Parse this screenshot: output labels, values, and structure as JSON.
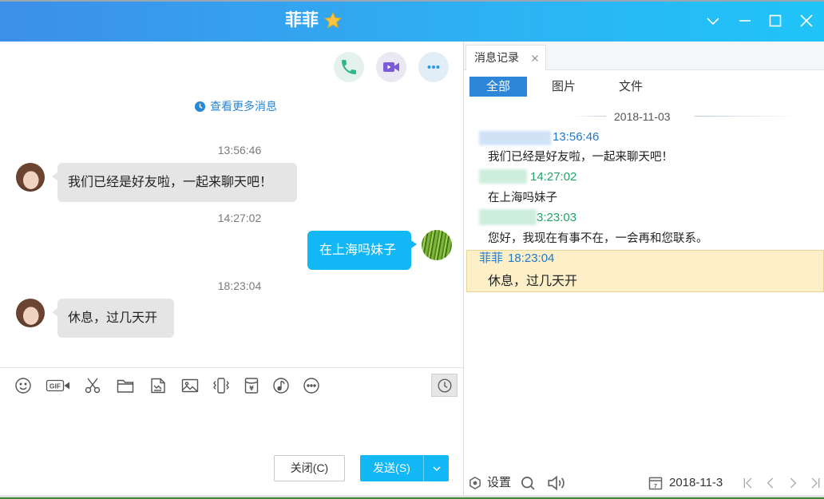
{
  "window": {
    "title": "菲菲",
    "controls": [
      "chevron-down-icon",
      "minimize-icon",
      "maximize-icon",
      "close-icon"
    ]
  },
  "chat": {
    "actions": [
      "phone-icon",
      "video-icon",
      "more-icon"
    ],
    "load_more_label": "查看更多消息",
    "messages": [
      {
        "from": "contact",
        "time": "13:56:46",
        "text": "我们已经是好友啦，一起来聊天吧！"
      },
      {
        "from": "me",
        "time": "14:27:02",
        "text": "在上海吗妹子"
      },
      {
        "from": "contact",
        "time": "18:23:04",
        "text": "休息，过几天开"
      }
    ]
  },
  "composer": {
    "toolbar_icons": [
      "emoji-icon",
      "gif-icon",
      "screenshot-scissors-icon",
      "folder-icon",
      "document-icon",
      "image-icon",
      "shake-icon",
      "red-packet-icon",
      "music-icon",
      "more-icon",
      "history-clock-icon"
    ],
    "gif_glyph": "GIF",
    "red_packet_glyph": "¥",
    "close_label": "关闭(C)",
    "send_label": "发送(S)"
  },
  "history": {
    "tab_label": "消息记录",
    "filters": [
      {
        "label": "全部",
        "selected": true
      },
      {
        "label": "图片",
        "selected": false
      },
      {
        "label": "文件",
        "selected": false
      }
    ],
    "date_header": "2018-11-03",
    "entries": [
      {
        "sender_redacted": true,
        "time": "13:56:46",
        "text": "我们已经是好友啦，一起来聊天吧！"
      },
      {
        "sender_redacted": true,
        "time": "14:27:02",
        "text": "在上海吗妹子"
      },
      {
        "sender_redacted": true,
        "time": "3:23:03",
        "text": "您好，我现在有事不在，一会再和您联系。"
      },
      {
        "sender": "菲菲",
        "time": "18:23:04",
        "text": "休息，过几天开",
        "selected": true
      }
    ],
    "footer": {
      "settings_label": "设置",
      "calendar_glyph": "7",
      "date": "2018-11-3",
      "nav_icons": [
        "first-page-icon",
        "prev-page-icon",
        "next-page-icon",
        "last-page-icon"
      ]
    }
  },
  "colors": {
    "titlebar_start": "#3d8fe8",
    "titlebar_end": "#1fc4f8",
    "accent_blue": "#12b7f5",
    "filter_selected": "#2d86d7",
    "history_time_blue": "#1f78cc",
    "history_time_green": "#21a366",
    "selected_row_bg": "#fdf0c9"
  }
}
